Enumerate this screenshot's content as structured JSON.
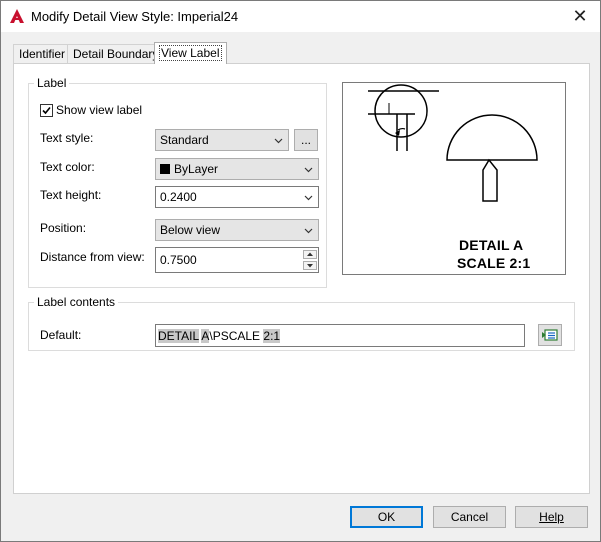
{
  "window": {
    "title": "Modify Detail View Style: Imperial24",
    "close_glyph": "✕"
  },
  "tabs": [
    {
      "label": "Identifier",
      "active": false
    },
    {
      "label": "Detail Boundary",
      "active": false
    },
    {
      "label": "View Label",
      "active": true
    }
  ],
  "label_group": {
    "legend": "Label",
    "show_view_label": {
      "label": "Show view label",
      "checked": true
    },
    "text_style": {
      "label": "Text style:",
      "value": "Standard",
      "browse_label": "..."
    },
    "text_color": {
      "label": "Text color:",
      "value": "ByLayer",
      "swatch": "#000000"
    },
    "text_height": {
      "label": "Text height:",
      "value": "0.2400"
    },
    "position": {
      "label": "Position:",
      "value": "Below view"
    },
    "distance": {
      "label": "Distance from view:",
      "value": "0.7500"
    }
  },
  "preview": {
    "line1": "DETAIL A",
    "line2": "SCALE 2:1"
  },
  "contents_group": {
    "legend": "Label contents",
    "default_label": "Default:",
    "segments": [
      {
        "text": "DETAIL",
        "hl": true
      },
      {
        "text": " ",
        "hl": false
      },
      {
        "text": "A",
        "hl": true
      },
      {
        "text": "\\PSCALE ",
        "hl": false
      },
      {
        "text": "2:1",
        "hl": true
      }
    ]
  },
  "buttons": {
    "ok": "OK",
    "cancel": "Cancel",
    "help": "Help"
  },
  "colors": {
    "accent": "#0078d7",
    "autocad_red": "#c8102e",
    "field_highlight": "#c8c8c8"
  }
}
